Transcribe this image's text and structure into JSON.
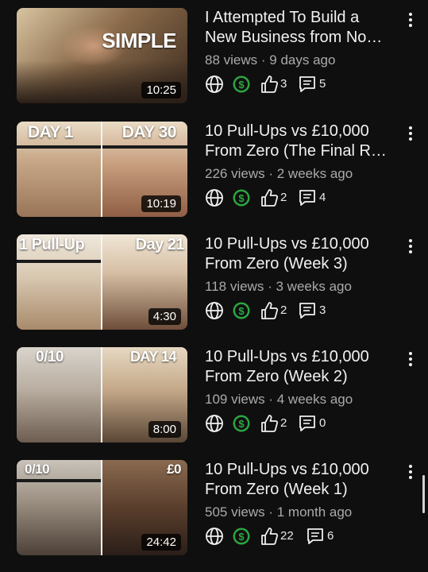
{
  "videos": [
    {
      "title_lines": [
        "I Attempted To Build a",
        "New Business from No…"
      ],
      "views": "88 views",
      "age": "9 days ago",
      "duration": "10:25",
      "likes": "3",
      "comments": "5",
      "overlay_left": "SIMPLE",
      "overlay_right": ""
    },
    {
      "title_lines": [
        "10 Pull-Ups vs £10,000",
        "From Zero (The Final R…"
      ],
      "views": "226 views",
      "age": "2 weeks ago",
      "duration": "10:19",
      "likes": "2",
      "comments": "4",
      "overlay_left": "DAY 1",
      "overlay_right": "DAY 30"
    },
    {
      "title_lines": [
        "10 Pull-Ups vs £10,000",
        "From Zero (Week 3)"
      ],
      "views": "118 views",
      "age": "3 weeks ago",
      "duration": "4:30",
      "likes": "2",
      "comments": "3",
      "overlay_left": "1 Pull-Up",
      "overlay_right": "Day 21"
    },
    {
      "title_lines": [
        "10 Pull-Ups vs £10,000",
        "From Zero (Week 2)"
      ],
      "views": "109 views",
      "age": "4 weeks ago",
      "duration": "8:00",
      "likes": "2",
      "comments": "0",
      "overlay_left": "0/10",
      "overlay_right": "DAY 14"
    },
    {
      "title_lines": [
        "10 Pull-Ups vs £10,000",
        "From Zero (Week 1)"
      ],
      "views": "505 views",
      "age": "1 month ago",
      "duration": "24:42",
      "likes": "22",
      "comments": "6",
      "overlay_left": "0/10",
      "overlay_right": "£0"
    }
  ],
  "meta_separator": "·",
  "icons": {
    "visibility": "globe-icon",
    "monetization": "dollar-icon",
    "likes": "thumbs-up-icon",
    "comments": "comment-icon",
    "menu": "more-vert-icon"
  },
  "colors": {
    "background": "#0f0f0f",
    "monetized": "#2ba640",
    "text": "#f1f1f1",
    "secondary_text": "#aaaaaa"
  }
}
